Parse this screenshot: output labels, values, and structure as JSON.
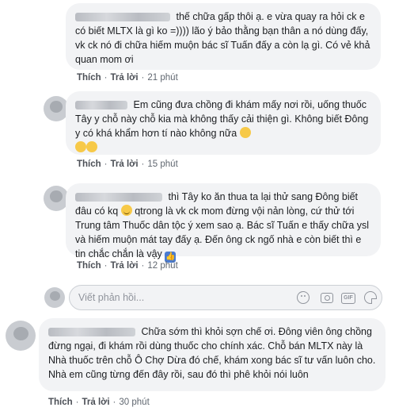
{
  "comments": [
    {
      "text": "thế chữa gấp thôi ạ. e vừa quay ra hỏi ck e có biết MLTX là gì ko =)))) lão ý bảo thằng bạn thân a nó dùng đấy, vk ck nó đi chữa hiếm muộn bác sĩ Tuấn đấy a còn lạ gì. Có vẻ khả quan mom ơi",
      "like": "Thích",
      "reply": "Trả lời",
      "time": "21 phút"
    },
    {
      "text": "Em cũng đưa chồng đi khám mấy nơi rồi, uống thuốc Tây y chỗ này chỗ kia mà không thấy cải thiện gì. Không biết Đông y có khá khẩm hơn tí nào không nữa",
      "like": "Thích",
      "reply": "Trả lời",
      "time": "15 phút"
    },
    {
      "text_a": "thì Tây ko ăn thua ta lại thử sang Đông biết đâu có kq",
      "text_b": "qtrong là vk ck mom đừng vội nản lòng, cứ thử tới Trung tâm Thuốc dân tộc ý xem sao ạ. Bác sĩ Tuấn e thấy chữa ysl và hiếm muộn mát tay đấy ạ. Đến ông ck ngố nhà e còn biết thì e tin chắc chắn là vậy",
      "like": "Thích",
      "reply": "Trả lời",
      "time": "12 phút"
    },
    {
      "text": "Chữa sớm thì khỏi sợn chế ơi. Đông viên ông chồng đừng ngại, đi khám rồi dùng thuốc cho chính xác. Chỗ bán MLTX này là Nhà thuốc trên chỗ Ô Chợ Dừa đó chế, khám xong bác sĩ tư vấn luôn cho. Nhà em cũng từng đến đây rồi, sau đó thì phê khỏi nói luôn",
      "like": "Thích",
      "reply": "Trả lời",
      "time": "30 phút"
    }
  ],
  "reply_box": {
    "placeholder": "Viết phản hồi..."
  },
  "colors": {
    "bubble": "#f2f3f5",
    "text": "#1c1e21",
    "meta": "#606770"
  }
}
